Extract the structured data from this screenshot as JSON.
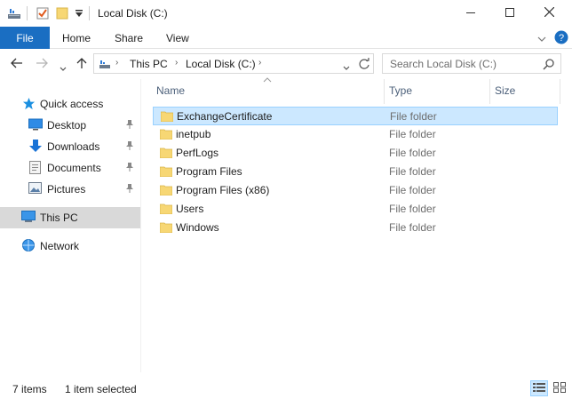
{
  "window": {
    "title": "Local Disk (C:)",
    "quick_access_icons": [
      "drive-icon",
      "properties-check-icon",
      "new-folder-icon",
      "customize-qat-icon"
    ],
    "controls": [
      "minimize-icon",
      "maximize-icon",
      "close-icon"
    ]
  },
  "ribbon": {
    "tabs": [
      "File",
      "Home",
      "Share",
      "View"
    ],
    "accent_color": "#1a6ec2"
  },
  "address": {
    "crumbs": [
      "This PC",
      "Local Disk (C:)"
    ],
    "search_placeholder": "Search Local Disk (C:)"
  },
  "sidebar": {
    "items": [
      {
        "label": "Quick access",
        "icon": "star-icon"
      },
      {
        "label": "Desktop",
        "icon": "desktop-icon",
        "pinned": true
      },
      {
        "label": "Downloads",
        "icon": "download-icon",
        "pinned": true
      },
      {
        "label": "Documents",
        "icon": "documents-icon",
        "pinned": true
      },
      {
        "label": "Pictures",
        "icon": "pictures-icon",
        "pinned": true
      },
      {
        "label": "This PC",
        "icon": "computer-icon",
        "selected": true
      },
      {
        "label": "Network",
        "icon": "network-icon"
      }
    ]
  },
  "files": {
    "columns": [
      "Name",
      "Type",
      "Size"
    ],
    "rows": [
      {
        "name": "ExchangeCertificate",
        "type": "File folder",
        "selected": true
      },
      {
        "name": "inetpub",
        "type": "File folder"
      },
      {
        "name": "PerfLogs",
        "type": "File folder"
      },
      {
        "name": "Program Files",
        "type": "File folder"
      },
      {
        "name": "Program Files (x86)",
        "type": "File folder"
      },
      {
        "name": "Users",
        "type": "File folder"
      },
      {
        "name": "Windows",
        "type": "File folder"
      }
    ]
  },
  "status": {
    "item_count": "7 items",
    "selection": "1 item selected"
  }
}
